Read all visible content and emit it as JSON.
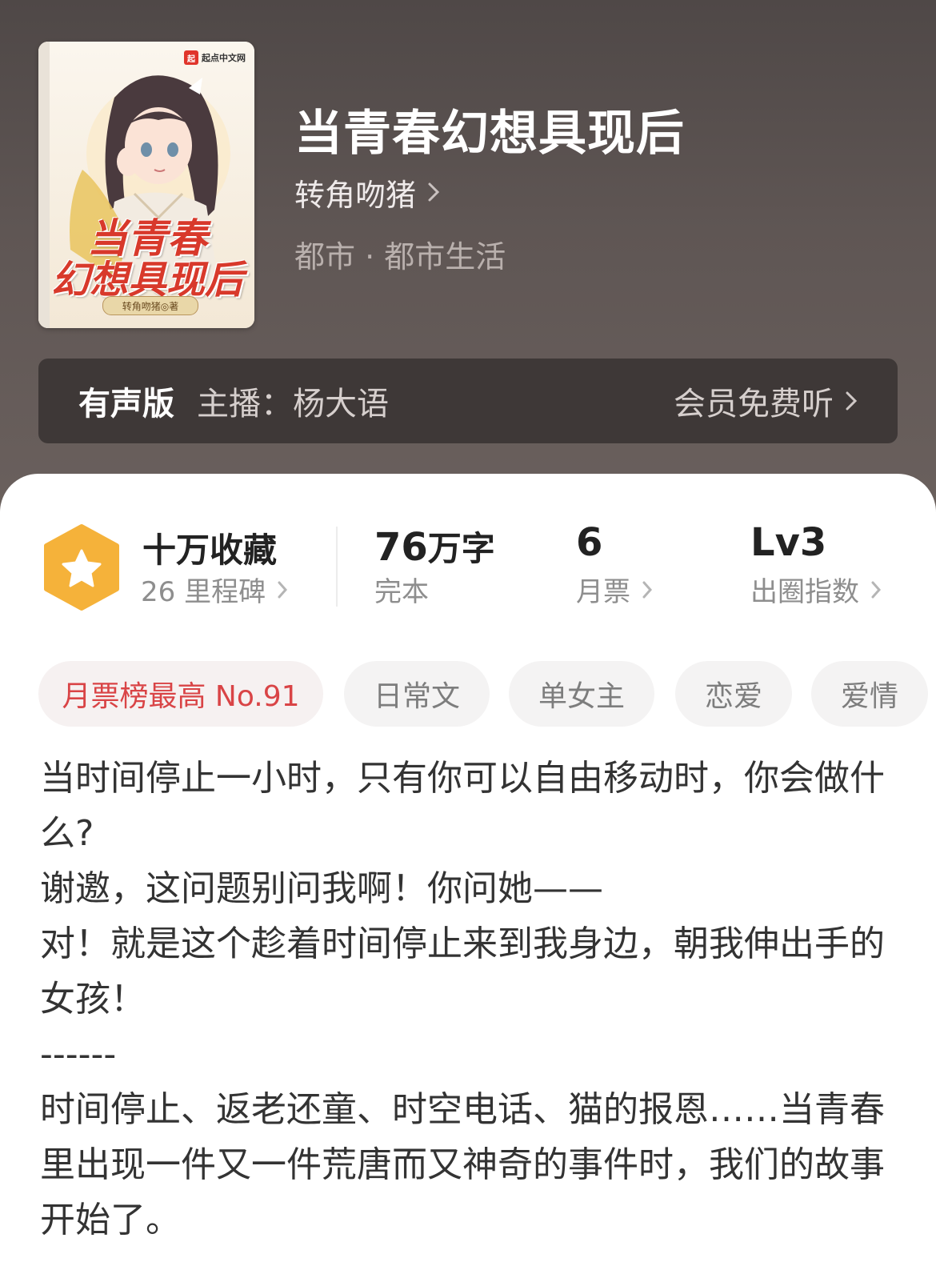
{
  "cover": {
    "brand": "起点中文网",
    "title_line1": "当青春",
    "title_line2": "幻想具现后",
    "author_plate": "转角吻猪◎著"
  },
  "book": {
    "title": "当青春幻想具现后",
    "author": "转角吻猪",
    "category": "都市 · 都市生活"
  },
  "audio": {
    "label": "有声版",
    "host": "主播：杨大语",
    "cta": "会员免费听"
  },
  "stats": {
    "collect_title": "十万收藏",
    "collect_sub": "26 里程碑",
    "words_value": "76",
    "words_unit": "万字",
    "words_sub": "完本",
    "tickets_value": "6",
    "tickets_sub": "月票",
    "circle_value": "Lv3",
    "circle_sub": "出圈指数"
  },
  "tags": [
    "月票榜最高 No.91",
    "日常文",
    "单女主",
    "恋爱",
    "爱情"
  ],
  "description": [
    "当时间停止一小时，只有你可以自由移动时，你会做什么?",
    "谢邀，这问题别问我啊！你问她——",
    "对！就是这个趁着时间停止来到我身边，朝我伸出手的女孩！",
    "------",
    "时间停止、返老还童、时空电话、猫的报恩……当青春里出现一件又一件荒唐而又神奇的事件时，我们的故事开始了。"
  ],
  "colors": {
    "hero_bg": "#5d5553",
    "audio_bg": "#3e3837",
    "accent_red": "#d94446",
    "badge_orange": "#f5b23a"
  },
  "icons": [
    "star-badge-icon",
    "chevron-right-icon"
  ]
}
